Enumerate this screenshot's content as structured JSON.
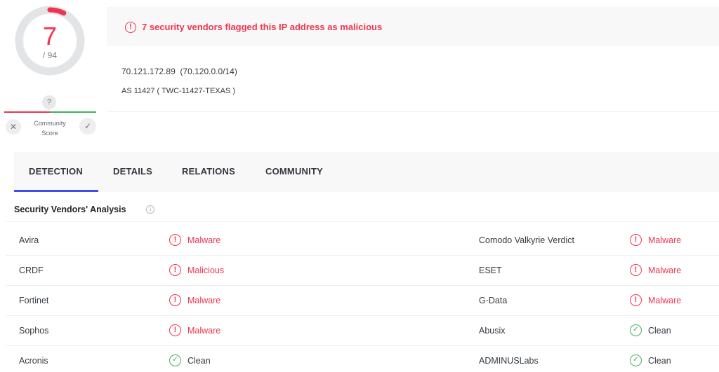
{
  "score": {
    "detections": "7",
    "total": "/ 94",
    "ratio": 0.0745,
    "colors": {
      "detected": "#f0344f",
      "ring": "#e3e4e6"
    }
  },
  "community": {
    "unknown_glyph": "?",
    "label_line1": "Community",
    "label_line2": "Score",
    "down_icon": "close-icon",
    "up_icon": "check-icon"
  },
  "alert": {
    "icon": "alert-circle-icon",
    "text": "7 security vendors flagged this IP address as malicious"
  },
  "ip": {
    "address": "70.121.172.89",
    "range": "(70.120.0.0/14)",
    "as": "AS 11427 ( TWC-11427-TEXAS )"
  },
  "tabs": [
    {
      "label": "DETECTION",
      "active": true
    },
    {
      "label": "DETAILS",
      "active": false
    },
    {
      "label": "RELATIONS",
      "active": false
    },
    {
      "label": "COMMUNITY",
      "active": false
    }
  ],
  "section": {
    "title": "Security Vendors' Analysis",
    "info_icon": "info-icon"
  },
  "vendors": [
    {
      "left": {
        "name": "Avira",
        "verdict": "Malware",
        "status": "malicious"
      },
      "right": {
        "name": "Comodo Valkyrie Verdict",
        "verdict": "Malware",
        "status": "malicious"
      }
    },
    {
      "left": {
        "name": "CRDF",
        "verdict": "Malicious",
        "status": "malicious"
      },
      "right": {
        "name": "ESET",
        "verdict": "Malware",
        "status": "malicious"
      }
    },
    {
      "left": {
        "name": "Fortinet",
        "verdict": "Malware",
        "status": "malicious"
      },
      "right": {
        "name": "G-Data",
        "verdict": "Malware",
        "status": "malicious"
      }
    },
    {
      "left": {
        "name": "Sophos",
        "verdict": "Malware",
        "status": "malicious"
      },
      "right": {
        "name": "Abusix",
        "verdict": "Clean",
        "status": "clean"
      }
    },
    {
      "left": {
        "name": "Acronis",
        "verdict": "Clean",
        "status": "clean"
      },
      "right": {
        "name": "ADMINUSLabs",
        "verdict": "Clean",
        "status": "clean"
      }
    }
  ],
  "colors": {
    "malicious": "#f0344f",
    "clean": "#3fb25a",
    "accent": "#3c4ef0"
  }
}
